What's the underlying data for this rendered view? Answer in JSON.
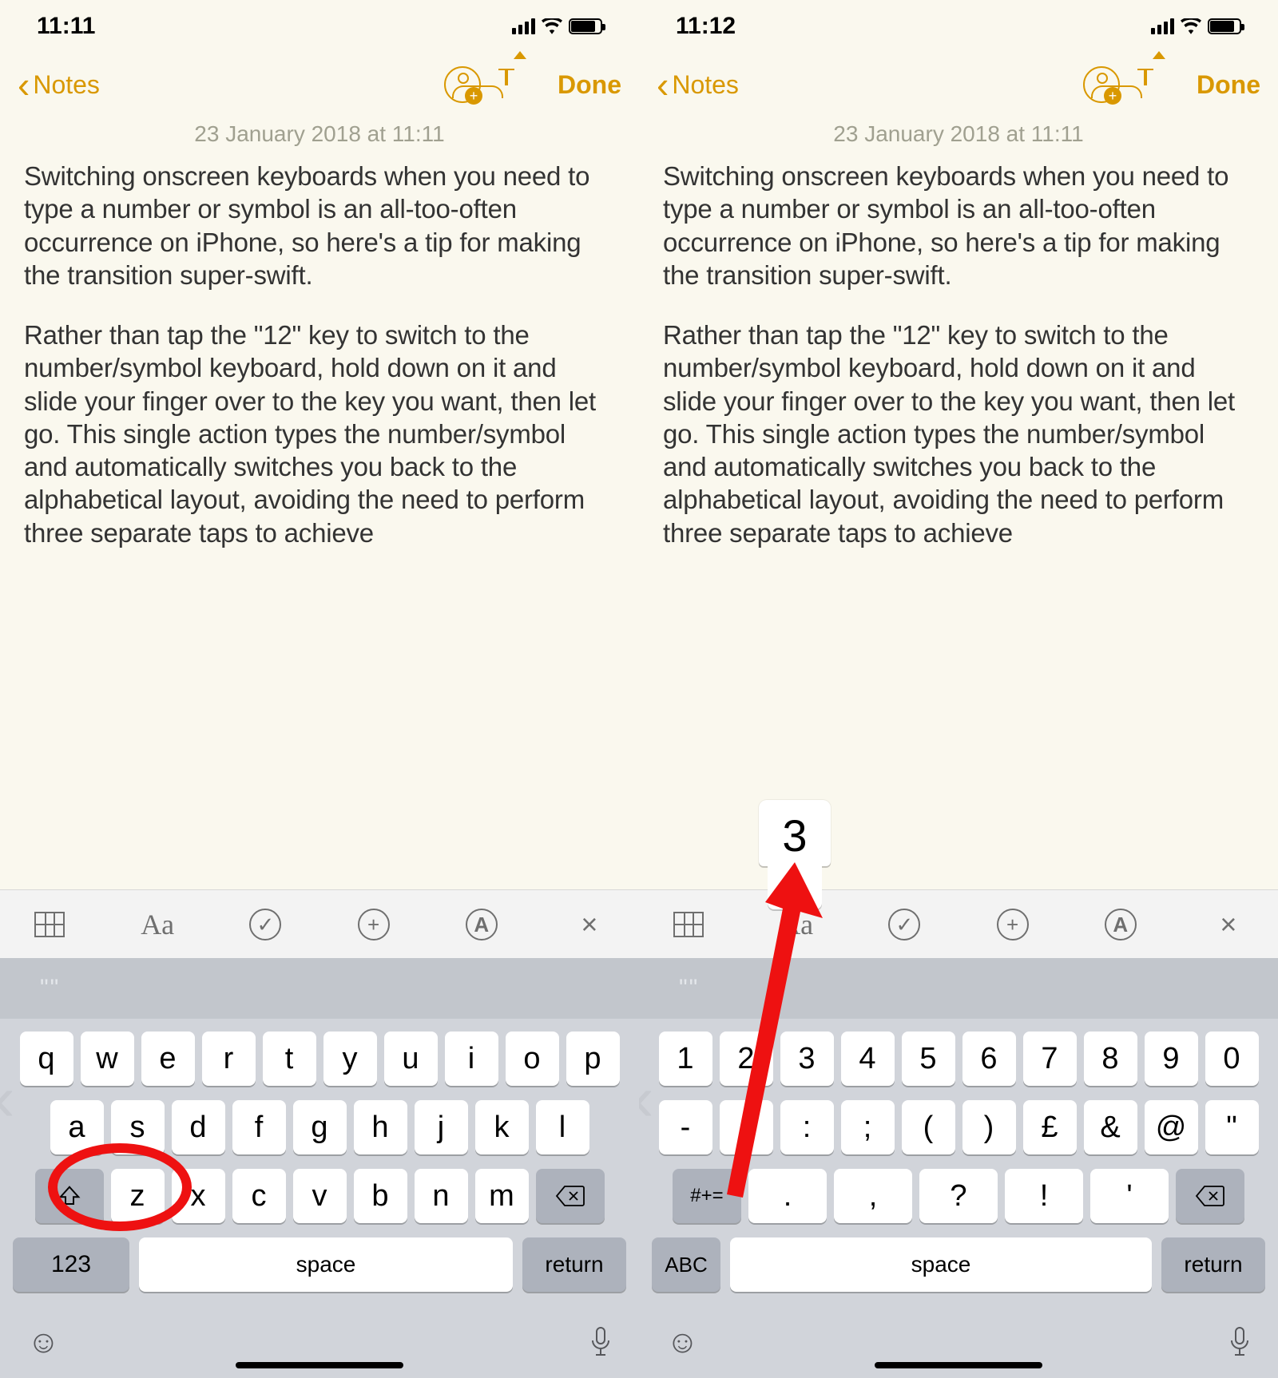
{
  "left": {
    "status": {
      "time": "11:11"
    },
    "nav": {
      "back_label": "Notes",
      "done_label": "Done"
    },
    "note": {
      "timestamp": "23 January 2018 at 11:11",
      "para1": "Switching onscreen keyboards when you need to type a number or symbol is an all-too-often occurrence on iPhone, so here's a tip for making the transition super-swift.",
      "para2": "Rather than tap the \"12\" key to switch to the number/symbol keyboard, hold down on it and slide your finger over to the key you want, then let go. This single action types the number/symbol and automatically switches you back to the alphabetical layout, avoiding the need to perform three separate taps to achieve"
    },
    "fmt": {
      "text_style": "Aa"
    },
    "suggestion": "\"\"",
    "keyboard": {
      "row1": [
        "q",
        "w",
        "e",
        "r",
        "t",
        "y",
        "u",
        "i",
        "o",
        "p"
      ],
      "row2": [
        "a",
        "s",
        "d",
        "f",
        "g",
        "h",
        "j",
        "k",
        "l"
      ],
      "row3": [
        "z",
        "x",
        "c",
        "v",
        "b",
        "n",
        "m"
      ],
      "numswitch": "123",
      "space": "space",
      "return": "return"
    }
  },
  "right": {
    "status": {
      "time": "11:12"
    },
    "nav": {
      "back_label": "Notes",
      "done_label": "Done"
    },
    "note": {
      "timestamp": "23 January 2018 at 11:11",
      "para1": "Switching onscreen keyboards when you need to type a number or symbol is an all-too-often occurrence on iPhone, so here's a tip for making the transition super-swift.",
      "para2": "Rather than tap the \"12\" key to switch to the number/symbol keyboard, hold down on it and slide your finger over to the key you want, then let go. This single action types the number/symbol and automatically switches you back to the alphabetical layout, avoiding the need to perform three separate taps to achieve"
    },
    "fmt": {
      "text_style": "Aa"
    },
    "suggestion": "\"\"",
    "keyboard": {
      "row1": [
        "1",
        "2",
        "3",
        "4",
        "5",
        "6",
        "7",
        "8",
        "9",
        "0"
      ],
      "row2": [
        "-",
        "/",
        ":",
        ";",
        "(",
        ")",
        "£",
        "&",
        "@",
        "\""
      ],
      "row3": [
        ".",
        ",",
        "?",
        "!",
        "'"
      ],
      "symswitch": "#+=",
      "abc": "ABC",
      "space": "space",
      "return": "return"
    },
    "popup": "3"
  }
}
